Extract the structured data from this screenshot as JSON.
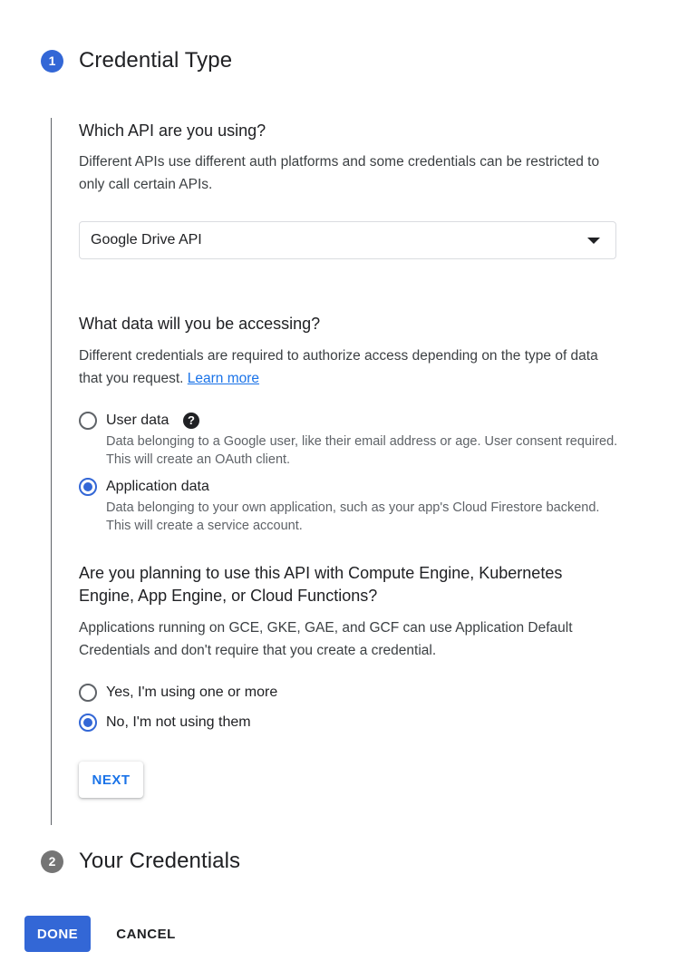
{
  "steps": [
    {
      "number": "1",
      "title": "Credential Type"
    },
    {
      "number": "2",
      "title": "Your Credentials"
    }
  ],
  "api_section": {
    "question": "Which API are you using?",
    "description": "Different APIs use different auth platforms and some credentials can be restricted to only call certain APIs.",
    "select_value": "Google Drive API"
  },
  "data_section": {
    "question": "What data will you be accessing?",
    "description": "Different credentials are required to authorize access depending on the type of data that you request.",
    "learn_more": "Learn more",
    "options": [
      {
        "label": "User data",
        "sub": "Data belonging to a Google user, like their email address or age. User consent required. This will create an OAuth client.",
        "checked": false
      },
      {
        "label": "Application data",
        "sub": "Data belonging to your own application, such as your app's Cloud Firestore backend. This will create a service account.",
        "checked": true
      }
    ],
    "help_icon": "?"
  },
  "compute_section": {
    "question": "Are you planning to use this API with Compute Engine, Kubernetes Engine, App Engine, or Cloud Functions?",
    "description": "Applications running on GCE, GKE, GAE, and GCF can use Application Default Credentials and don't require that you create a credential.",
    "options": [
      {
        "label": "Yes, I'm using one or more",
        "checked": false
      },
      {
        "label": "No, I'm not using them",
        "checked": true
      }
    ]
  },
  "buttons": {
    "next": "NEXT",
    "done": "DONE",
    "cancel": "CANCEL"
  },
  "colors": {
    "accent": "#3367d6",
    "link": "#1a73e8",
    "inactive_step": "#757575"
  }
}
